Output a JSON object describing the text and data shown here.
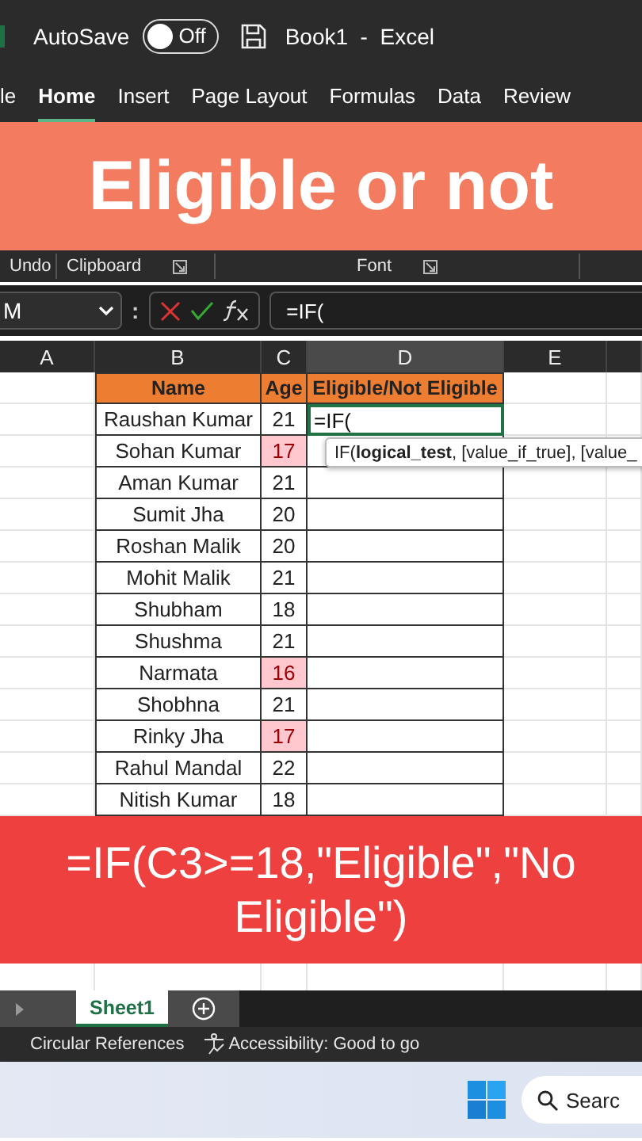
{
  "title_bar": {
    "autosave_label": "AutoSave",
    "autosave": {
      "on": false,
      "label": "Off"
    },
    "title": "Book1  -  Excel"
  },
  "ribbon_tabs": [
    {
      "label": "le",
      "selected": false
    },
    {
      "label": "Home",
      "selected": true
    },
    {
      "label": "Insert",
      "selected": false
    },
    {
      "label": "Page Layout",
      "selected": false
    },
    {
      "label": "Formulas",
      "selected": false
    },
    {
      "label": "Data",
      "selected": false
    },
    {
      "label": "Review",
      "selected": false
    }
  ],
  "banner": "Eligible or not",
  "ribbon_groups": [
    {
      "label": "Undo",
      "launcher": false
    },
    {
      "label": "Clipboard",
      "launcher": true
    },
    {
      "label": "Font",
      "launcher": true
    }
  ],
  "formula_bar": {
    "name_box": "M",
    "separator": ":",
    "formula": "=IF("
  },
  "columns": [
    {
      "label": "A",
      "selected": false
    },
    {
      "label": "B",
      "selected": false
    },
    {
      "label": "C",
      "selected": false
    },
    {
      "label": "D",
      "selected": true
    },
    {
      "label": "E",
      "selected": false
    }
  ],
  "table": {
    "headers": [
      "Name",
      "Age",
      "Eligible/Not Eligible"
    ],
    "rows": [
      {
        "name": "Raushan Kumar",
        "age": "21",
        "highlighted": false,
        "result": "=IF("
      },
      {
        "name": "Sohan Kumar",
        "age": "17",
        "highlighted": true
      },
      {
        "name": "Aman Kumar",
        "age": "21",
        "highlighted": false
      },
      {
        "name": "Sumit Jha",
        "age": "20",
        "highlighted": false
      },
      {
        "name": "Roshan Malik",
        "age": "20",
        "highlighted": false
      },
      {
        "name": "Mohit Malik",
        "age": "21",
        "highlighted": false
      },
      {
        "name": "Shubham",
        "age": "18",
        "highlighted": false
      },
      {
        "name": "Shushma",
        "age": "21",
        "highlighted": false
      },
      {
        "name": "Narmata",
        "age": "16",
        "highlighted": true
      },
      {
        "name": "Shobhna",
        "age": "21",
        "highlighted": false
      },
      {
        "name": "Rinky Jha",
        "age": "17",
        "highlighted": true
      },
      {
        "name": "Rahul Mandal",
        "age": "22",
        "highlighted": false
      },
      {
        "name": "Nitish Kumar",
        "age": "18",
        "highlighted": false
      }
    ]
  },
  "tooltip": "IF(**logical_test**, [value_if_true], [value_",
  "formula_banner": [
    "=IF(C3>=18,\"Eligible\",\"No",
    "Eligible\")"
  ],
  "sheet_tabs": [
    {
      "label": "Sheet1",
      "selected": true
    }
  ],
  "status_bar": {
    "items": [
      "Circular References",
      "Accessibility: Good to go"
    ]
  },
  "taskbar": {
    "search": "Searc"
  }
}
